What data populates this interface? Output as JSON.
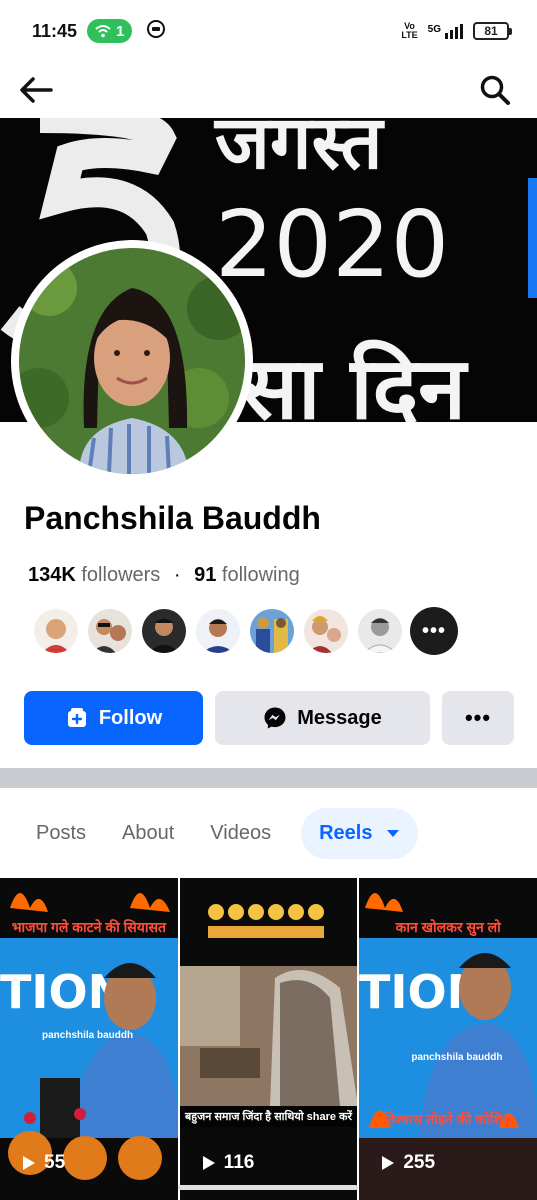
{
  "status_bar": {
    "time": "11:45",
    "wifi_count": "1",
    "volte_top": "Vo",
    "volte_bottom": "LTE",
    "network": "5G",
    "battery": "81"
  },
  "profile": {
    "name": "Panchshila Bauddh",
    "followers_count": "134K",
    "followers_label": "followers",
    "following_count": "91",
    "following_label": "following"
  },
  "actions": {
    "follow_label": "Follow",
    "message_label": "Message",
    "more_label": "•••"
  },
  "friends_more_label": "•••",
  "tabs": [
    {
      "label": "Posts"
    },
    {
      "label": "About"
    },
    {
      "label": "Videos"
    },
    {
      "label": "Reels"
    }
  ],
  "reels": [
    {
      "count": "55",
      "caption": "भाजपा गले काटने की सियासत",
      "watermark": "panchshila bauddh"
    },
    {
      "count": "116",
      "subtitle": "बहुजन समाज जिंदा है साथियो share करें"
    },
    {
      "count": "255",
      "caption": "कान खोलकर सुन लो",
      "watermark": "panchshila bauddh",
      "bottom_caption": "विश्वास तोड़ने की कोशिश"
    }
  ],
  "cover_text": {
    "line1": "जगस्त",
    "line2": "2020",
    "line3": "सा दिन"
  },
  "colors": {
    "accent": "#0866ff",
    "button_gray": "#e4e6eb",
    "tab_active_bg": "#ebf3ff",
    "wifi_green": "#2fbf5b"
  },
  "icons": [
    "back-arrow-icon",
    "search-icon",
    "add-friend-icon",
    "messenger-icon",
    "dropdown-caret-icon",
    "play-icon"
  ]
}
